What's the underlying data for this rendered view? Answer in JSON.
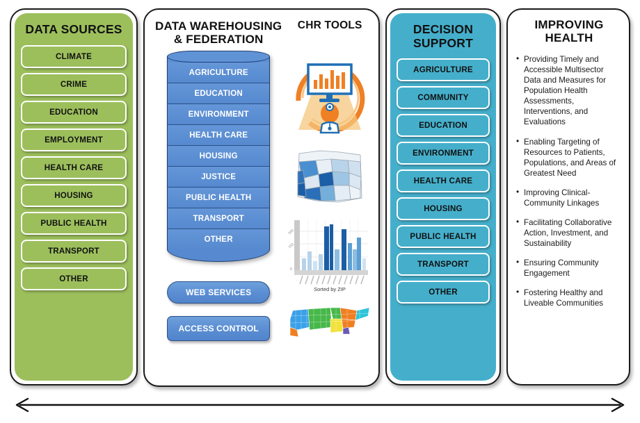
{
  "columns": {
    "data_sources": {
      "title": "DATA SOURCES",
      "items": [
        "CLIMATE",
        "CRIME",
        "EDUCATION",
        "EMPLOYMENT",
        "HEALTH CARE",
        "HOUSING",
        "PUBLIC HEALTH",
        "TRANSPORT",
        "OTHER"
      ],
      "fill_color": "#9cbf5c"
    },
    "data_warehousing": {
      "title": "DATA WAREHOUSING & FEDERATION",
      "cylinder_items": [
        "AGRICULTURE",
        "EDUCATION",
        "ENVIRONMENT",
        "HEALTH CARE",
        "HOUSING",
        "JUSTICE",
        "PUBLIC HEALTH",
        "TRANSPORT",
        "OTHER"
      ],
      "web_services_label": "WEB SERVICES",
      "access_control_label": "ACCESS CONTROL",
      "fill_color": "#5d90d4"
    },
    "chr_tools": {
      "title": "CHR TOOLS",
      "artwork": [
        "dashboard-monitor-person-illustration",
        "county-choropleth-map",
        "sorted-bar-chart",
        "state-regions-map"
      ],
      "bar_chart_caption": "Sorted by ZIP"
    },
    "decision_support": {
      "title": "DECISION SUPPORT",
      "items": [
        "AGRICULTURE",
        "COMMUNITY",
        "EDUCATION",
        "ENVIRONMENT",
        "HEALTH CARE",
        "HOUSING",
        "PUBLIC HEALTH",
        "TRANSPORT",
        "OTHER"
      ],
      "fill_color": "#45afcb"
    },
    "improving_health": {
      "title": "IMPROVING HEALTH",
      "bullets": [
        "Providing Timely and Accessible Multisector Data and Measures for Population Health Assessments, Interventions, and Evaluations",
        "Enabling Targeting of Resources to Patients, Populations, and Areas of Greatest Need",
        "Improving Clinical-Community Linkages",
        "Facilitating Collaborative Action, Investment, and Sustainability",
        "Ensuring Community Engagement",
        "Fostering Healthy and Liveable Communities"
      ]
    }
  },
  "bottom_arrow": {
    "icon": "double-headed-arrow-icon"
  }
}
